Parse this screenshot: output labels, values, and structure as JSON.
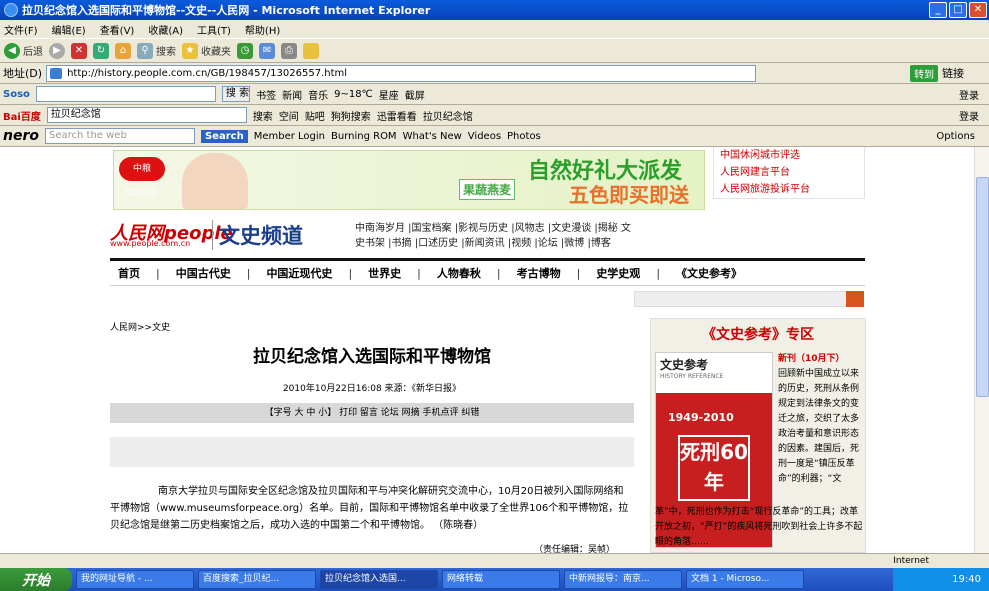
{
  "window": {
    "title": "拉贝纪念馆入选国际和平博物馆--文史--人民网 - Microsoft Internet Explorer"
  },
  "menu": [
    "文件(F)",
    "编辑(E)",
    "查看(V)",
    "收藏(A)",
    "工具(T)",
    "帮助(H)"
  ],
  "toolbar": {
    "back": "后退",
    "search": "搜索",
    "favorites": "收藏夹"
  },
  "address": {
    "label": "地址(D)",
    "url": "http://history.people.com.cn/GB/198457/13026557.html",
    "go": "转到",
    "links": "链接"
  },
  "soso": {
    "search_btn": "搜 索",
    "items": [
      "书签",
      "新闻",
      "音乐",
      "9~18℃",
      "星座",
      "截屏"
    ],
    "login": "登录"
  },
  "baidu": {
    "input": "拉贝纪念馆",
    "items": [
      "搜索",
      "空间",
      "贴吧",
      "狗狗搜索",
      "迅雷看看",
      "拉贝纪念馆"
    ],
    "login": "登录"
  },
  "nero": {
    "placeholder": "Search the web",
    "search": "Search",
    "items": [
      "Member Login",
      "Burning ROM",
      "What's New",
      "Videos",
      "Photos"
    ],
    "options": "Options"
  },
  "page": {
    "side_links": [
      "中国休闲城市评选",
      "人民网建言平台",
      "人民网旅游投诉平台"
    ],
    "banner": {
      "logo": "中粮 COFCO",
      "brand": "果蔬燕麦",
      "title": "自然好礼大派发",
      "sub": "五色即买即送"
    },
    "logo": "人民网people",
    "logo_url": "www.people.com.cn",
    "channel": "文史频道",
    "top_links": "中南海岁月 |国宝档案 |影视与历史 |风物志 |文史漫谈 |揭秘 文史书架 |书摘 |口述历史 |新闻资讯 |视频 |论坛 |微博 |博客",
    "nav": [
      "首页",
      "中国古代史",
      "中国近现代史",
      "世界史",
      "人物春秋",
      "考古博物",
      "史学史观",
      "《文史参考》"
    ],
    "breadcrumb": "人民网>>文史",
    "title": "拉贝纪念馆入选国际和平博物馆",
    "meta": "2010年10月22日16:08  来源：《新华日报》",
    "tools": "【字号 大 中 小】 打印 留言 论坛 网摘 手机点评 纠错",
    "body": "南京大学拉贝与国际安全区纪念馆及拉贝国际和平与冲突化解研究交流中心，10月20日被列入国际网络和平博物馆（www.museumsforpeace.org）名单。目前，国际和平博物馆名单中收录了全世界106个和平博物馆，拉贝纪念馆是继第二历史档案馆之后，成功入选的中国第二个和平博物馆。 （陈晓春）",
    "editor": "（责任编辑：吴帧）",
    "panel": {
      "title": "《文史参考》专区",
      "mag": "文史参考",
      "mag_en": "HISTORY REFERENCE",
      "years": "1949-2010",
      "cover": "死刑60年",
      "issue": "新刊（10月下）",
      "text1": "回顾新中国成立以来的历史，死刑从条例规定到法律条文的变迁之旅，交织了太多政治考量和意识形态的因素。建国后，死刑一度是“镇压反革命”的利器；“文",
      "text2": "革”中，死刑也作为打击“现行反革命”的工具；改革开放之初，“严打”的疾风将死刑吹到社会上许多不起眼的角落……"
    }
  },
  "status": {
    "zone": "Internet"
  },
  "taskbar": {
    "start": "开始",
    "tasks": [
      "我的网址导航 - ...",
      "百度搜索_拉贝纪...",
      "拉贝纪念馆入选国...",
      "网络转载",
      "中新网报导：南京...",
      "文档 1 - Microso..."
    ],
    "clock": "19:40"
  }
}
